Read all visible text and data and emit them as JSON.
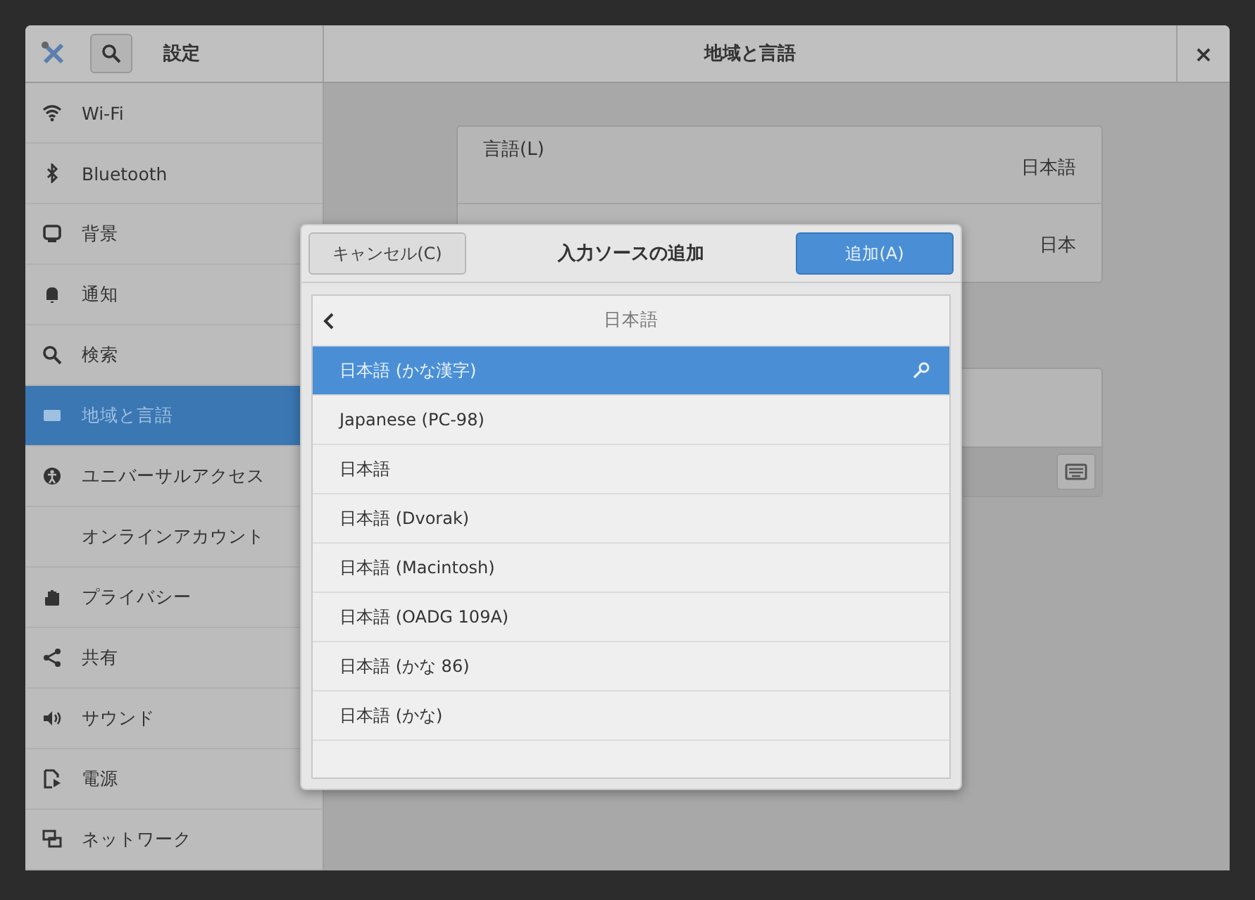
{
  "window": {
    "sidebar_title": "設定",
    "title": "地域と言語",
    "close": "×"
  },
  "sidebar": {
    "items": [
      {
        "label": "Wi-Fi",
        "selected": false
      },
      {
        "label": "Bluetooth",
        "selected": false
      },
      {
        "label": "背景",
        "selected": false
      },
      {
        "label": "通知",
        "selected": false
      },
      {
        "label": "検索",
        "selected": false
      },
      {
        "label": "地域と言語",
        "selected": true
      },
      {
        "label": "ユニバーサルアクセス",
        "selected": false
      },
      {
        "label": "オンラインアカウント",
        "selected": false
      },
      {
        "label": "プライバシー",
        "selected": false
      },
      {
        "label": "共有",
        "selected": false
      },
      {
        "label": "サウンド",
        "selected": false
      },
      {
        "label": "電源",
        "selected": false
      },
      {
        "label": "ネットワーク",
        "selected": false
      }
    ]
  },
  "language_panel": {
    "rows": [
      {
        "label": "言語(L)",
        "value": "日本語"
      },
      {
        "value": "日本"
      }
    ]
  },
  "dialog": {
    "cancel_button": "キャンセル(C)",
    "title": "入力ソースの追加",
    "add_button": "追加(A)",
    "list_header": "日本語",
    "items": [
      {
        "label": "日本語 (かな漢字)",
        "selected": true,
        "settings": true
      },
      {
        "label": "Japanese (PC-98)",
        "selected": false,
        "settings": false
      },
      {
        "label": "日本語",
        "selected": false,
        "settings": false
      },
      {
        "label": "日本語 (Dvorak)",
        "selected": false,
        "settings": false
      },
      {
        "label": "日本語 (Macintosh)",
        "selected": false,
        "settings": false
      },
      {
        "label": "日本語 (OADG 109A)",
        "selected": false,
        "settings": false
      },
      {
        "label": "日本語 (かな 86)",
        "selected": false,
        "settings": false
      },
      {
        "label": "日本語 (かな)",
        "selected": false,
        "settings": false
      }
    ]
  }
}
